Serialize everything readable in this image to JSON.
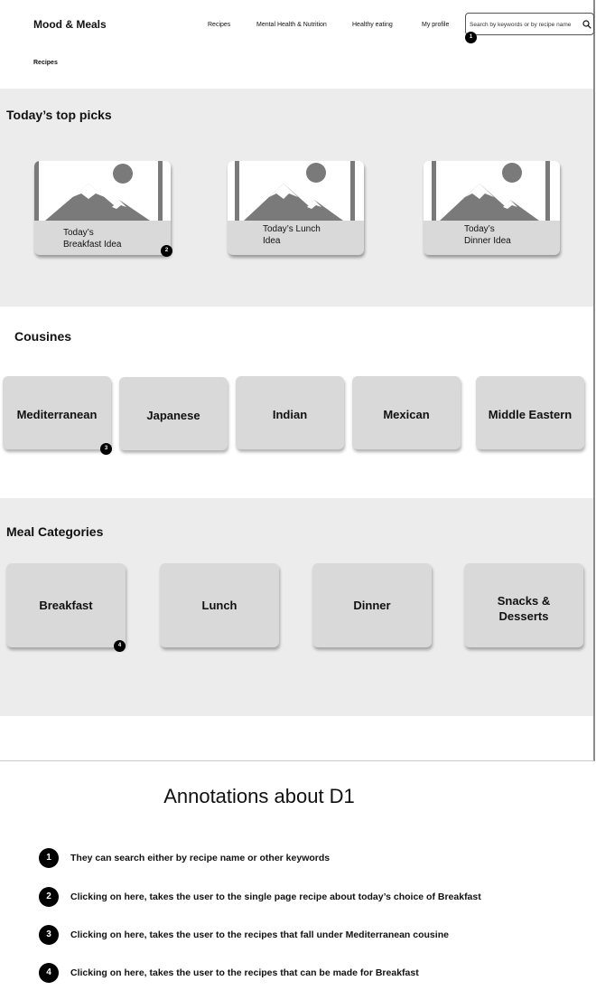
{
  "header": {
    "brand": "Mood & Meals",
    "nav": [
      "Recipes",
      "Mental Health & Nutrition",
      "Healthy eating",
      "My profile"
    ],
    "search_placeholder": "Search by keywords or by recipe name",
    "search_icon": "search-icon",
    "subnav": "Recipes"
  },
  "top_picks": {
    "title": "Today’s top picks",
    "cards": [
      {
        "line1": "Today’s",
        "line2": "Breakfast Idea"
      },
      {
        "line1": "Today’s Lunch",
        "line2": "Idea"
      },
      {
        "line1": "Today’s",
        "line2": "Dinner Idea"
      }
    ]
  },
  "cuisines": {
    "title": "Cousines",
    "items": [
      "Mediterranean",
      "Japanese",
      "Indian",
      "Mexican",
      "Middle Eastern"
    ]
  },
  "meal_categories": {
    "title": "Meal Categories",
    "items": [
      {
        "line1": "Breakfast",
        "line2": ""
      },
      {
        "line1": "Lunch",
        "line2": ""
      },
      {
        "line1": "Dinner",
        "line2": ""
      },
      {
        "line1": "Snacks &",
        "line2": "Desserts"
      }
    ]
  },
  "badges": [
    "1",
    "2",
    "3",
    "4"
  ],
  "annotations": {
    "title": "Annotations about D1",
    "items": [
      {
        "num": "1",
        "text": "They can search either by recipe name or other keywords"
      },
      {
        "num": "2",
        "text": "Clicking on here, takes the user to the single page recipe about today’s choice of Breakfast"
      },
      {
        "num": "3",
        "text": "Clicking on here, takes the user to the recipes that fall under Mediterranean cousine"
      },
      {
        "num": "4",
        "text": "Clicking on here, takes the user to the recipes that can be made for Breakfast"
      }
    ]
  }
}
